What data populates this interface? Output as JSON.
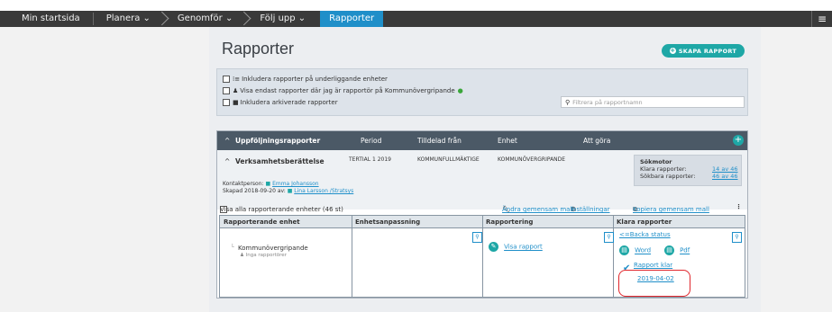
{
  "nav": {
    "home": "Min startsida",
    "planera": "Planera ⌄",
    "genomfor": "Genomför ⌄",
    "folj_upp": "Följ upp ⌄",
    "rapporter": "Rapporter",
    "menu_icon": "≡"
  },
  "page": {
    "title": "Rapporter",
    "create_button": "SKAPA RAPPORT"
  },
  "filters": {
    "include_sub_units": "Inkludera rapporter på underliggande enheter",
    "only_reporter": "Visa endast rapporter där jag är rapportör på Kommunövergripande",
    "include_archived": "Inkludera arkiverade rapporter",
    "search_placeholder": "Filtrera på rapportnamn"
  },
  "panel": {
    "header": {
      "title": "Uppföljningsrapporter",
      "period": "Period",
      "tilldelad_fran": "Tilldelad från",
      "enhet": "Enhet",
      "att_gora": "Att göra"
    },
    "report": {
      "name": "Verksamhetsberättelse",
      "period": "TERTIAL 1 2019",
      "from": "KOMMUNFULLMÄKTIGE",
      "unit": "KOMMUNÖVERGRIPANDE",
      "contact_label": "Kontaktperson:",
      "contact_name": "Emma Johansson",
      "created_label": "Skapad 2018-09-20 av:",
      "created_by": "Lina Larsson /Stratsys"
    },
    "sokmotor": {
      "title": "Sökmotor",
      "klara_label": "Klara rapporter:",
      "klara_value": "14 av 46",
      "sokbara_label": "Sökbara rapporter:",
      "sokbara_value": "46 av 46"
    },
    "toolbar": {
      "show_all": "Visa alla rapporterande enheter (46 st)",
      "change_template": "Ändra gemensam mall",
      "settings": "Inställningar",
      "copy_template": "Kopiera gemensam mall",
      "more": "⋮"
    },
    "table": {
      "headers": [
        "Rapporterande enhet",
        "Enhetsanpassning",
        "Rapportering",
        "Klara rapporter"
      ],
      "unit_name": "Kommunövergripande",
      "no_reporters": "Inga rapportörer",
      "view_report": "Visa rapport",
      "back_status": "<=Backa status",
      "word": "Word",
      "pdf": "Pdf",
      "report_ready": "Rapport klar",
      "report_date": "2019-04-02"
    }
  },
  "colors": {
    "nav_bg": "#3a3a3a",
    "nav_active": "#1f8fc9",
    "accent_teal": "#1ea7a6",
    "panel_header": "#4b5966",
    "annotation": "#e0262c"
  }
}
